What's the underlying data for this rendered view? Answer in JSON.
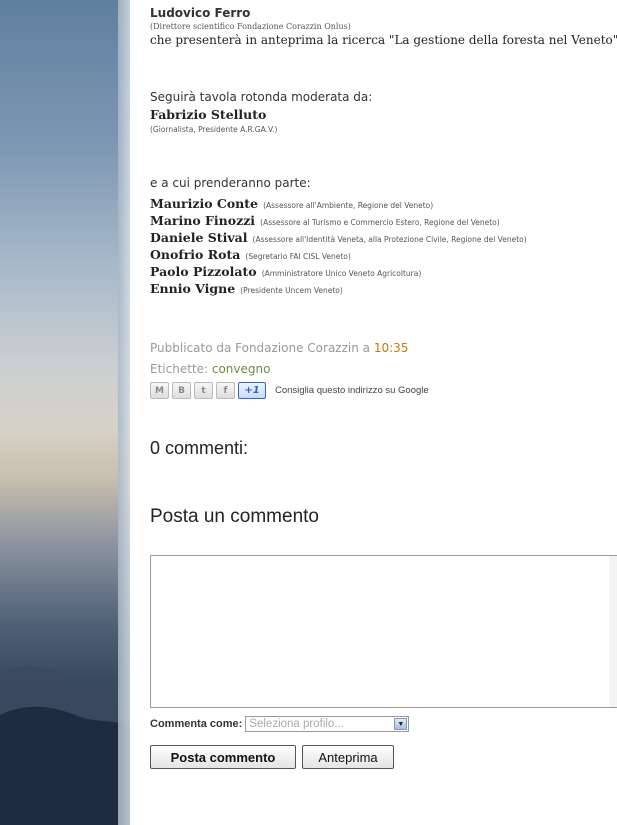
{
  "post": {
    "speaker_name": "Ludovico Ferro",
    "speaker_role": "(Direttore scientifico Fondazione Corazzin Onlus)",
    "intro_line": "che presenterà in anteprima la ricerca \"La gestione della foresta nel Veneto\"",
    "moderator_intro": "Seguirà tavola rotonda moderata da:",
    "moderator_name": "Fabrizio Stelluto",
    "moderator_role": "(Giornalista, Presidente A.R.GA.V.)",
    "participants_intro": "e a cui prenderanno parte:",
    "participants": [
      {
        "name": "Maurizio Conte",
        "role": "(Assessore all'Ambiente, Regione del Veneto)"
      },
      {
        "name": "Marino Finozzi",
        "role": "(Assessore al Turismo e Commercio Estero, Regione del Veneto)"
      },
      {
        "name": "Daniele Stival",
        "role": "(Assessore all'Identità Veneta, alla Protezione Civile, Regione del Veneto)"
      },
      {
        "name": "Onofrio Rota",
        "role": "(Segretario FAI CISL Veneto)"
      },
      {
        "name": "Paolo Pizzolato",
        "role": "(Amministratore Unico Veneto Agricoltura)"
      },
      {
        "name": "Ennio Vigne",
        "role": "(Presidente Uncem Veneto)"
      }
    ]
  },
  "footer": {
    "published_by": "Pubblicato da Fondazione Corazzin a ",
    "time": "10:35",
    "labels_prefix": "Etichette: ",
    "label": "convegno"
  },
  "share": {
    "plus_one": "+1",
    "recommend_text": "Consiglia questo indirizzo su Google",
    "icons": [
      "email-icon",
      "blogger-icon",
      "twitter-icon",
      "facebook-icon",
      "google-plus-one-icon"
    ]
  },
  "comments": {
    "count_heading": "0 commenti:",
    "post_heading": "Posta un commento",
    "comment_as_label": "Commenta come:",
    "profile_select": "Seleziona profilo...",
    "submit_label": "Posta commento",
    "preview_label": "Anteprima"
  },
  "colors": {
    "time": "#c57a00",
    "label_link": "#6a8f3a",
    "meta_text": "#999999"
  }
}
